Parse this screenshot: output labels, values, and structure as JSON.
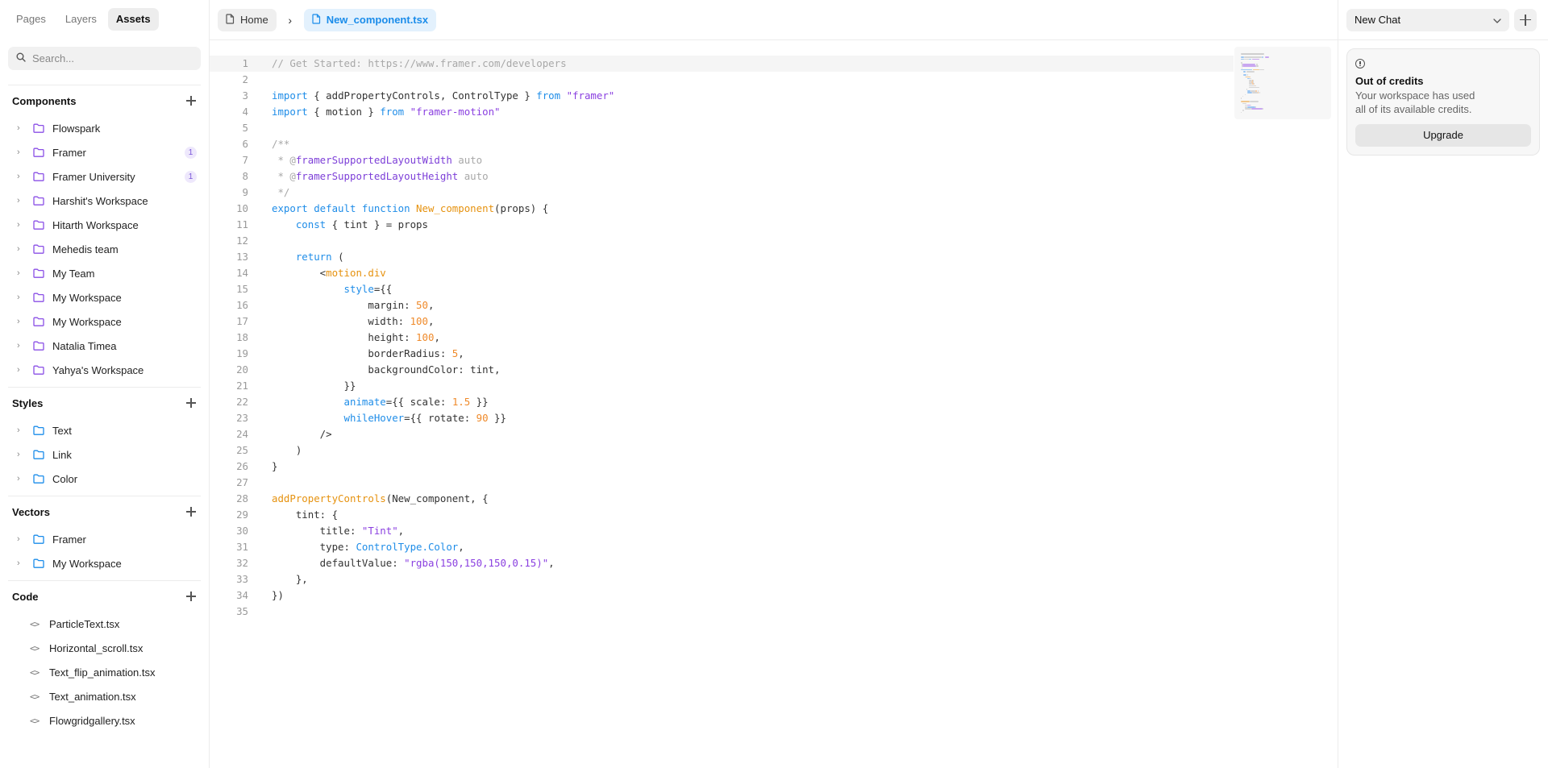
{
  "sidebar": {
    "tabs": [
      {
        "label": "Pages",
        "active": false
      },
      {
        "label": "Layers",
        "active": false
      },
      {
        "label": "Assets",
        "active": true
      }
    ],
    "search_placeholder": "Search...",
    "components": {
      "title": "Components",
      "items": [
        {
          "label": "Flowspark",
          "badge": ""
        },
        {
          "label": "Framer",
          "badge": "1"
        },
        {
          "label": "Framer University",
          "badge": "1"
        },
        {
          "label": "Harshit's Workspace",
          "badge": ""
        },
        {
          "label": "Hitarth Workspace",
          "badge": ""
        },
        {
          "label": "Mehedis team",
          "badge": ""
        },
        {
          "label": "My Team",
          "badge": ""
        },
        {
          "label": "My Workspace",
          "badge": ""
        },
        {
          "label": "My Workspace",
          "badge": ""
        },
        {
          "label": "Natalia Timea",
          "badge": ""
        },
        {
          "label": "Yahya's Workspace",
          "badge": ""
        }
      ]
    },
    "styles": {
      "title": "Styles",
      "items": [
        {
          "label": "Text"
        },
        {
          "label": "Link"
        },
        {
          "label": "Color"
        }
      ]
    },
    "vectors": {
      "title": "Vectors",
      "items": [
        {
          "label": "Framer"
        },
        {
          "label": "My Workspace"
        }
      ]
    },
    "code": {
      "title": "Code",
      "items": [
        {
          "label": "ParticleText.tsx"
        },
        {
          "label": "Horizontal_scroll.tsx"
        },
        {
          "label": "Text_flip_animation.tsx"
        },
        {
          "label": "Text_animation.tsx"
        },
        {
          "label": "Flowgridgallery.tsx"
        }
      ]
    }
  },
  "breadcrumb": {
    "home": "Home",
    "file": "New_component.tsx"
  },
  "editor": {
    "lines": [
      [
        [
          "com",
          "// Get Started: https://www.framer.com/developers"
        ]
      ],
      [],
      [
        [
          "kw",
          "import"
        ],
        [
          "",
          " { addPropertyControls, ControlType } "
        ],
        [
          "kw",
          "from"
        ],
        [
          "",
          " "
        ],
        [
          "str",
          "\"framer\""
        ]
      ],
      [
        [
          "kw",
          "import"
        ],
        [
          "",
          " { motion } "
        ],
        [
          "kw",
          "from"
        ],
        [
          "",
          " "
        ],
        [
          "str",
          "\"framer-motion\""
        ]
      ],
      [],
      [
        [
          "com",
          "/**"
        ]
      ],
      [
        [
          "com",
          " * @"
        ],
        [
          "dec",
          "framerSupportedLayoutWidth"
        ],
        [
          "com",
          " auto"
        ]
      ],
      [
        [
          "com",
          " * @"
        ],
        [
          "dec",
          "framerSupportedLayoutHeight"
        ],
        [
          "com",
          " auto"
        ]
      ],
      [
        [
          "com",
          " */"
        ]
      ],
      [
        [
          "kw",
          "export default function"
        ],
        [
          "",
          " "
        ],
        [
          "fn",
          "New_component"
        ],
        [
          "",
          "(props) {"
        ]
      ],
      [
        [
          "",
          "    "
        ],
        [
          "kw",
          "const"
        ],
        [
          "",
          " { tint } = props"
        ]
      ],
      [],
      [
        [
          "",
          "    "
        ],
        [
          "kw",
          "return"
        ],
        [
          "",
          " ("
        ]
      ],
      [
        [
          "",
          "        <"
        ],
        [
          "fn",
          "motion.div"
        ]
      ],
      [
        [
          "",
          "            "
        ],
        [
          "attr",
          "style"
        ],
        [
          "",
          "={{"
        ]
      ],
      [
        [
          "",
          "                margin: "
        ],
        [
          "num",
          "50"
        ],
        [
          "",
          ","
        ]
      ],
      [
        [
          "",
          "                width: "
        ],
        [
          "num",
          "100"
        ],
        [
          "",
          ","
        ]
      ],
      [
        [
          "",
          "                height: "
        ],
        [
          "num",
          "100"
        ],
        [
          "",
          ","
        ]
      ],
      [
        [
          "",
          "                borderRadius: "
        ],
        [
          "num",
          "5"
        ],
        [
          "",
          ","
        ]
      ],
      [
        [
          "",
          "                backgroundColor: tint,"
        ]
      ],
      [
        [
          "",
          "            }}"
        ]
      ],
      [
        [
          "",
          "            "
        ],
        [
          "attr",
          "animate"
        ],
        [
          "",
          "={{ scale: "
        ],
        [
          "num",
          "1.5"
        ],
        [
          "",
          " }}"
        ]
      ],
      [
        [
          "",
          "            "
        ],
        [
          "attr",
          "whileHover"
        ],
        [
          "",
          "={{ rotate: "
        ],
        [
          "num",
          "90"
        ],
        [
          "",
          " }}"
        ]
      ],
      [
        [
          "",
          "        />"
        ]
      ],
      [
        [
          "",
          "    )"
        ]
      ],
      [
        [
          "",
          "}"
        ]
      ],
      [],
      [
        [
          "fn",
          "addPropertyControls"
        ],
        [
          "",
          "(New_component, {"
        ]
      ],
      [
        [
          "",
          "    tint: {"
        ]
      ],
      [
        [
          "",
          "        title: "
        ],
        [
          "str",
          "\"Tint\""
        ],
        [
          "",
          ","
        ]
      ],
      [
        [
          "",
          "        type: "
        ],
        [
          "kw",
          "ControlType.Color"
        ],
        [
          "",
          ","
        ]
      ],
      [
        [
          "",
          "        defaultValue: "
        ],
        [
          "str",
          "\"rgba(150,150,150,0.15)\""
        ],
        [
          "",
          ","
        ]
      ],
      [
        [
          "",
          "    },"
        ]
      ],
      [
        [
          "",
          "})"
        ]
      ],
      []
    ]
  },
  "chat": {
    "select_label": "New Chat",
    "credits_title": "Out of credits",
    "credits_desc": "Your workspace has used all of its available credits.",
    "upgrade_label": "Upgrade"
  },
  "colors": {
    "accent": "#1a8cea",
    "component_folder": "#8a4fe6",
    "style_folder": "#1a8cea"
  }
}
